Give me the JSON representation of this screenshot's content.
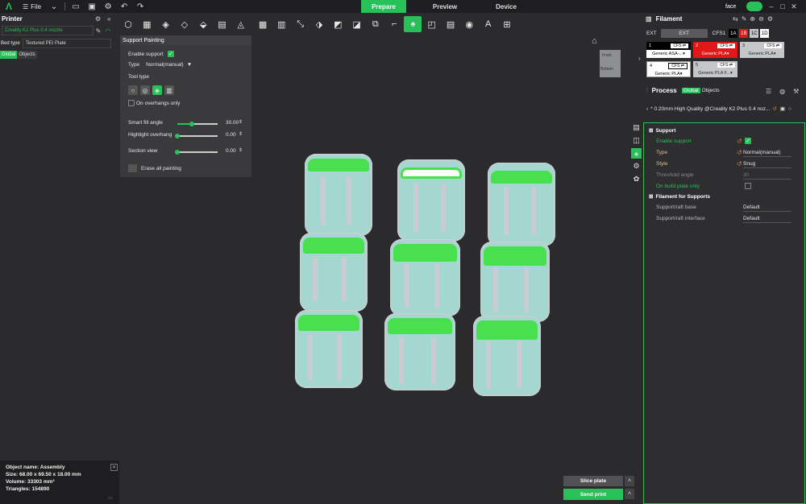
{
  "topbar": {
    "file_label": "File",
    "tabs": [
      "Prepare",
      "Preview",
      "Device"
    ],
    "user": "face"
  },
  "printer": {
    "title": "Printer",
    "name": "Creality K2 Plus 0.4 nozzle",
    "bed_type_label": "Bed type",
    "bed_type_value": "Textured PEI Plate",
    "seg_global": "Global",
    "seg_objects": "Objects"
  },
  "support_painting": {
    "title": "Support Painting",
    "enable_support": "Enable support",
    "type_label": "Type",
    "type_value": "Normal(manual)",
    "tool_type": "Tool type",
    "on_overhangs_only": "On overhangs only",
    "smart_fill_angle_label": "Smart fill angle",
    "smart_fill_angle_value": "30.00",
    "smart_fill_angle_level": 0.35,
    "highlight_overhang_label": "Highlight overhang",
    "highlight_overhang_value": "0.00",
    "highlight_overhang_level": 0.0,
    "section_view_label": "Section view",
    "section_view_value": "0.00",
    "section_view_level": 0.0,
    "erase_all": "Erase all painting"
  },
  "view_cube": {
    "front": "Front",
    "bottom": "Bottom"
  },
  "object_info": {
    "name": "Object name: Assembly",
    "size": "Size: 68.00 x 69.50 x 18.00 mm",
    "volume": "Volume: 33303 mm³",
    "triangles": "Triangles: 154890"
  },
  "actions": {
    "slice": "Slice plate",
    "send": "Send print"
  },
  "filament": {
    "title": "Filament",
    "ext_label": "EXT",
    "ext_box": "EXT",
    "cfs_label": "CFS1",
    "cfs_tags": [
      "1A",
      "1B",
      "1C",
      "1D"
    ],
    "slots": [
      {
        "num": "1",
        "badge": "CFS ⇄",
        "name": "Generic ASA-...",
        "bg": "#000000"
      },
      {
        "num": "2",
        "badge": "CFS ⇄",
        "name": "Generic PLA",
        "bg": "#e01818"
      },
      {
        "num": "3",
        "badge": "CFS ⇄",
        "name": "Generic PLA",
        "bg": "#c4c6c8"
      },
      {
        "num": "4",
        "badge": "CFS ⇄",
        "name": "Generic PLA",
        "bg": "#ffffff"
      },
      {
        "num": "5",
        "badge": "CFS ⇄",
        "name": "Generic PLA F...",
        "bg": "#c4c6c8"
      }
    ]
  },
  "process": {
    "title": "Process",
    "seg_global": "Global",
    "seg_objects": "Objects",
    "preset": "* 0.20mm High Quality @Creality K2 Plus 0.4 noz..."
  },
  "settings": {
    "support_head": "Support",
    "enable_support": "Enable support",
    "type_label": "Type",
    "type_value": "Normal(manual)",
    "style_label": "Style",
    "style_value": "Snug",
    "threshold_label": "Threshold angle",
    "threshold_value": "30",
    "build_plate_label": "On build plate only",
    "filament_head": "Filament for Supports",
    "raft_base_label": "Support/raft base",
    "raft_base_value": "Default",
    "raft_interface_label": "Support/raft interface",
    "raft_interface_value": "Default"
  },
  "colors": {
    "accent": "#27c059",
    "part": "#a3d7cf",
    "painted": "#48e04f"
  }
}
